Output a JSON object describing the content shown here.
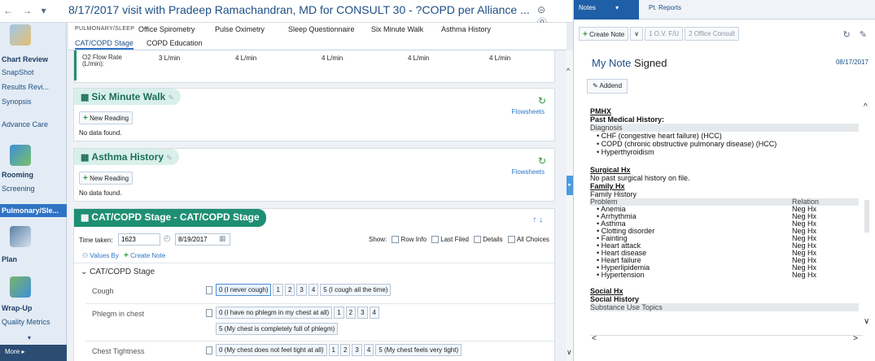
{
  "title_bar": {
    "nav": "← → ▾",
    "visit_title": "8/17/2017 visit with Pradeep Ramachandran, MD for CONSULT 30 - ?COPD per Alliance ...",
    "icons": "⊝ ⓪"
  },
  "sidebar": {
    "items": [
      {
        "label": "Chart Review"
      },
      {
        "label": "SnapShot"
      },
      {
        "label": "Results Revi..."
      },
      {
        "label": "Synopsis"
      },
      {
        "label": "Advance Care"
      },
      {
        "label": "Rooming"
      },
      {
        "label": "Screening"
      },
      {
        "label": "Pulmonary/Sle..."
      },
      {
        "label": "Plan"
      },
      {
        "label": "Wrap-Up"
      },
      {
        "label": "Quality Metrics"
      }
    ],
    "more": "More ▸",
    "collapse": "▾"
  },
  "tabs_row1": [
    {
      "label": "PULMONARY/SLEEP"
    },
    {
      "label": "Office Spirometry"
    },
    {
      "label": "Pulse Oximetry"
    },
    {
      "label": "Sleep Questionnaire"
    },
    {
      "label": "Six Minute Walk"
    },
    {
      "label": "Asthma History"
    }
  ],
  "tabs_row2": [
    {
      "label": "CAT/COPD Stage"
    },
    {
      "label": "COPD Education"
    }
  ],
  "o2_row": {
    "label": "O2 Flow Rate (L/min):",
    "values": [
      "3 L/min",
      "4 L/min",
      "4 L/min",
      "4 L/min",
      "4 L/min"
    ]
  },
  "six_minute_walk": {
    "title": "Six Minute Walk",
    "new_reading": "New Reading",
    "flowsheets": "Flowsheets",
    "no_data": "No data found."
  },
  "asthma_history": {
    "title": "Asthma History",
    "new_reading": "New Reading",
    "flowsheets": "Flowsheets",
    "no_data": "No data found."
  },
  "cat_copd": {
    "title": "CAT/COPD Stage - CAT/COPD Stage",
    "arrows": "↑ ↓",
    "time_taken_label": "Time taken:",
    "time_value": "1623",
    "date_value": "8/19/2017",
    "show_label": "Show:",
    "show_options": [
      "Row Info",
      "Last Filed",
      "Details",
      "All Choices"
    ],
    "values_by": "Values By",
    "create_note": "Create Note",
    "group_label": "CAT/COPD Stage",
    "rows": [
      {
        "label": "Cough",
        "choices": [
          "0 (I never cough)",
          "1",
          "2",
          "3",
          "4",
          "5 (I cough all the time)"
        ]
      },
      {
        "label": "Phlegm in chest",
        "choices": [
          "0 (I have no phlegm in my chest at all)",
          "1",
          "2",
          "3",
          "4"
        ],
        "choices2": [
          "5 (My chest is completely full of phlegm)"
        ]
      },
      {
        "label": "Chest Tightness",
        "choices": [
          "0 (My chest does not feel tight at all)",
          "1",
          "2",
          "3",
          "4",
          "5 (My chest feels very tight)"
        ]
      }
    ]
  },
  "right_panel": {
    "tabs": [
      "Notes",
      "Pt. Reports"
    ],
    "notes_dropdown": "▾",
    "toolbar": [
      "Create Note",
      "∨",
      "1 O.V. F/U",
      "2 Office Consult"
    ],
    "tools": "↻ ✎",
    "note_title": "My Note",
    "note_status": "Signed",
    "note_date": "08/17/2017",
    "addend": "Addend",
    "pmhx": {
      "heading": "PMHX",
      "sub": "Past Medical History:",
      "col": "Diagnosis",
      "items": [
        "CHF (congestive heart failure) (HCC)",
        "COPD (chronic obstructive pulmonary disease) (HCC)",
        "Hyperthyroidism"
      ]
    },
    "surgical": {
      "heading": "Surgical Hx",
      "text": "No past surgical history on file."
    },
    "family": {
      "heading": "Family Hx",
      "sub": "Family History",
      "col1": "Problem",
      "col2": "Relation",
      "rows": [
        [
          "Anemia",
          "Neg Hx"
        ],
        [
          "Arrhythmia",
          "Neg Hx"
        ],
        [
          "Asthma",
          "Neg Hx"
        ],
        [
          "Clotting disorder",
          "Neg Hx"
        ],
        [
          "Fainting",
          "Neg Hx"
        ],
        [
          "Heart attack",
          "Neg Hx"
        ],
        [
          "Heart disease",
          "Neg Hx"
        ],
        [
          "Heart failure",
          "Neg Hx"
        ],
        [
          "Hyperlipidemia",
          "Neg Hx"
        ],
        [
          "Hypertension",
          "Neg Hx"
        ]
      ]
    },
    "social": {
      "heading": "Social Hx",
      "sub": "Social History",
      "grey": "Substance Use Topics"
    },
    "scroll_up": "^",
    "scroll_down": "∨",
    "hscroll_left": "<",
    "hscroll_right": ">"
  }
}
